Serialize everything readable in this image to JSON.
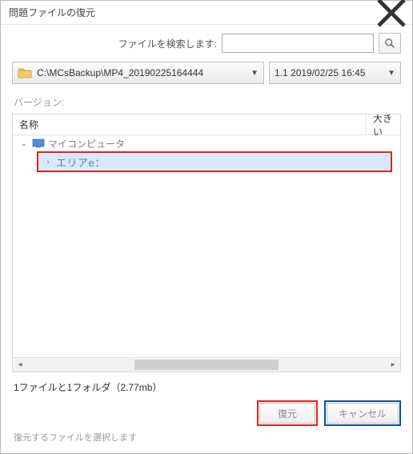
{
  "window": {
    "title": "問題ファイルの復元"
  },
  "search": {
    "label": "ファイルを検索します:",
    "value": "",
    "placeholder": ""
  },
  "path": {
    "value": "C:\\MCsBackup\\MP4_20190225164444"
  },
  "versionCombo": {
    "value": "1.1  2019/02/25 16:45"
  },
  "sectionLabel": "バージョン:",
  "columns": {
    "name": "名称",
    "size": "大きい"
  },
  "tree": {
    "root": {
      "label": "マイコンピュータ"
    },
    "child": {
      "label": "エリアe："
    }
  },
  "status": "1ファイルと1フォルダ（2.77mb）",
  "buttons": {
    "restore": "復元",
    "cancel": "キャンセル"
  },
  "hint": "復元するファイルを選択します"
}
